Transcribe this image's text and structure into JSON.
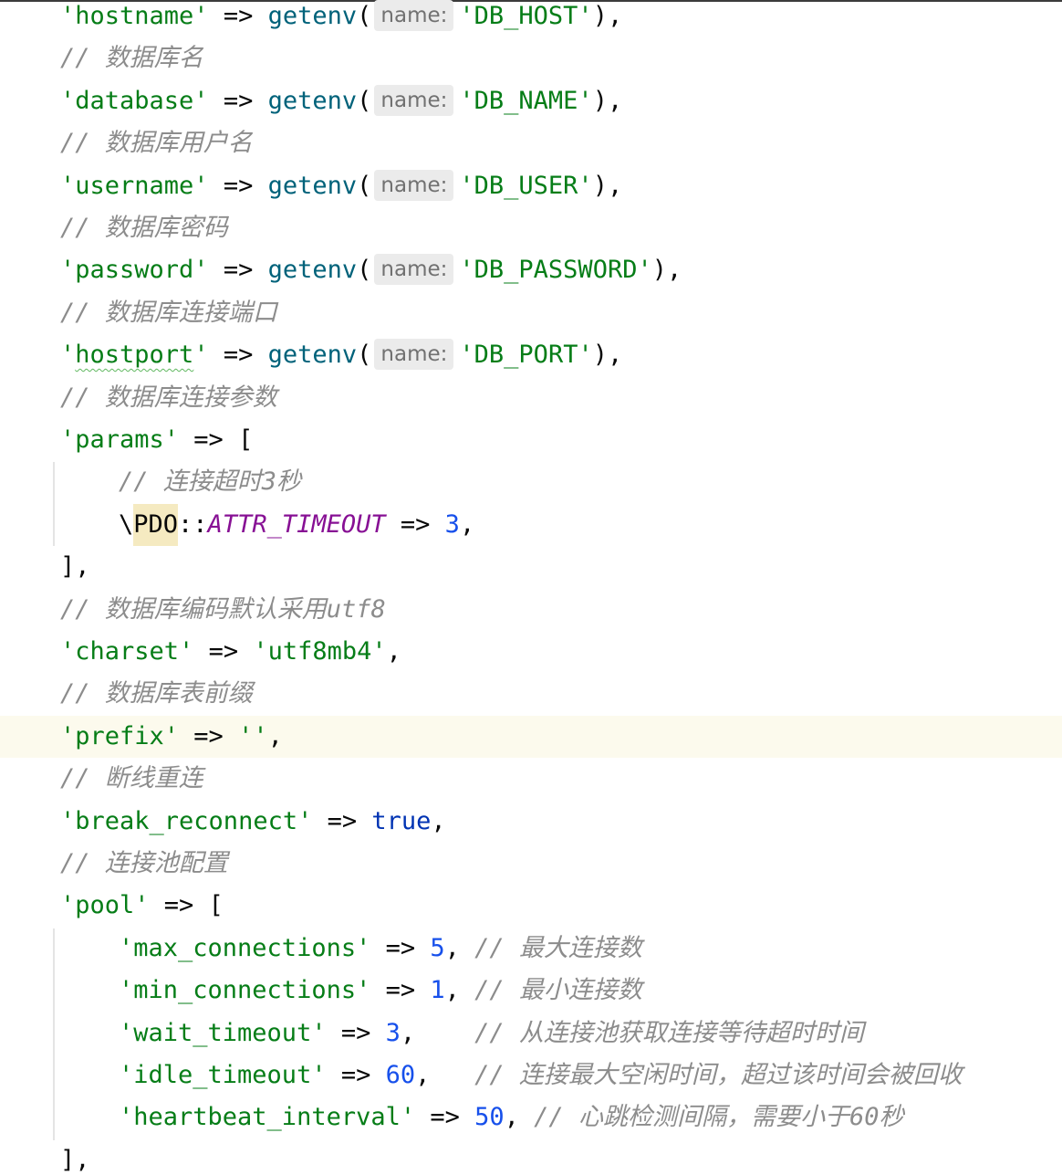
{
  "lines": [
    {
      "indent": 1,
      "tokens": [
        [
          "str",
          "'hostname'"
        ],
        [
          "op",
          " => "
        ],
        [
          "fn",
          "getenv"
        ],
        [
          "op",
          "("
        ],
        [
          "hint",
          "name:"
        ],
        [
          "str",
          "'DB_HOST'"
        ],
        [
          "op",
          "),"
        ]
      ]
    },
    {
      "indent": 1,
      "tokens": [
        [
          "cmt",
          "// 数据库名"
        ]
      ]
    },
    {
      "indent": 1,
      "tokens": [
        [
          "str",
          "'database'"
        ],
        [
          "op",
          " => "
        ],
        [
          "fn",
          "getenv"
        ],
        [
          "op",
          "("
        ],
        [
          "hint",
          "name:"
        ],
        [
          "str",
          "'DB_NAME'"
        ],
        [
          "op",
          "),"
        ]
      ]
    },
    {
      "indent": 1,
      "tokens": [
        [
          "cmt",
          "// 数据库用户名"
        ]
      ]
    },
    {
      "indent": 1,
      "tokens": [
        [
          "str",
          "'username'"
        ],
        [
          "op",
          " => "
        ],
        [
          "fn",
          "getenv"
        ],
        [
          "op",
          "("
        ],
        [
          "hint",
          "name:"
        ],
        [
          "str",
          "'DB_USER'"
        ],
        [
          "op",
          "),"
        ]
      ]
    },
    {
      "indent": 1,
      "tokens": [
        [
          "cmt",
          "// 数据库密码"
        ]
      ]
    },
    {
      "indent": 1,
      "tokens": [
        [
          "str",
          "'password'"
        ],
        [
          "op",
          " => "
        ],
        [
          "fn",
          "getenv"
        ],
        [
          "op",
          "("
        ],
        [
          "hint",
          "name:"
        ],
        [
          "str",
          "'DB_PASSWORD'"
        ],
        [
          "op",
          "),"
        ]
      ]
    },
    {
      "indent": 1,
      "tokens": [
        [
          "cmt",
          "// 数据库连接端口"
        ]
      ]
    },
    {
      "indent": 1,
      "tokens": [
        [
          "str",
          "'"
        ],
        [
          "typo",
          "hostport"
        ],
        [
          "str",
          "'"
        ],
        [
          "op",
          " => "
        ],
        [
          "fn",
          "getenv"
        ],
        [
          "op",
          "("
        ],
        [
          "hint",
          "name:"
        ],
        [
          "str",
          "'DB_PORT'"
        ],
        [
          "op",
          "),"
        ]
      ]
    },
    {
      "indent": 1,
      "tokens": [
        [
          "cmt",
          "// 数据库连接参数"
        ]
      ]
    },
    {
      "indent": 1,
      "tokens": [
        [
          "str",
          "'params'"
        ],
        [
          "op",
          " => ["
        ]
      ]
    },
    {
      "indent": 2,
      "tokens": [
        [
          "cmt",
          "// 连接超时3秒"
        ]
      ]
    },
    {
      "indent": 2,
      "tokens": [
        [
          "op",
          "\\"
        ],
        [
          "cls",
          "PDO"
        ],
        [
          "op",
          "::"
        ],
        [
          "const",
          "ATTR_TIMEOUT"
        ],
        [
          "op",
          " => "
        ],
        [
          "num",
          "3"
        ],
        [
          "op",
          ","
        ]
      ]
    },
    {
      "indent": 1,
      "tokens": [
        [
          "op",
          "],"
        ]
      ]
    },
    {
      "indent": 1,
      "tokens": [
        [
          "cmt",
          "// 数据库编码默认采用utf8"
        ]
      ]
    },
    {
      "indent": 1,
      "tokens": [
        [
          "str",
          "'charset'"
        ],
        [
          "op",
          " => "
        ],
        [
          "str",
          "'utf8mb4'"
        ],
        [
          "op",
          ","
        ]
      ]
    },
    {
      "indent": 1,
      "tokens": [
        [
          "cmt",
          "// 数据库表前缀"
        ]
      ]
    },
    {
      "indent": 1,
      "current": true,
      "tokens": [
        [
          "str",
          "'prefix'"
        ],
        [
          "op",
          " => "
        ],
        [
          "str",
          "''"
        ],
        [
          "op",
          ","
        ]
      ]
    },
    {
      "indent": 1,
      "tokens": [
        [
          "cmt",
          "// 断线重连"
        ]
      ]
    },
    {
      "indent": 1,
      "tokens": [
        [
          "str",
          "'break_reconnect'"
        ],
        [
          "op",
          " => "
        ],
        [
          "kw",
          "true"
        ],
        [
          "op",
          ","
        ]
      ]
    },
    {
      "indent": 1,
      "tokens": [
        [
          "cmt",
          "// 连接池配置"
        ]
      ]
    },
    {
      "indent": 1,
      "tokens": [
        [
          "str",
          "'pool'"
        ],
        [
          "op",
          " => ["
        ]
      ]
    },
    {
      "indent": 2,
      "tokens": [
        [
          "str",
          "'max_connections'"
        ],
        [
          "op",
          " => "
        ],
        [
          "num",
          "5"
        ],
        [
          "op",
          ", "
        ],
        [
          "cmt",
          "// 最大连接数"
        ]
      ]
    },
    {
      "indent": 2,
      "tokens": [
        [
          "str",
          "'min_connections'"
        ],
        [
          "op",
          " => "
        ],
        [
          "num",
          "1"
        ],
        [
          "op",
          ", "
        ],
        [
          "cmt",
          "// 最小连接数"
        ]
      ]
    },
    {
      "indent": 2,
      "tokens": [
        [
          "str",
          "'wait_timeout'"
        ],
        [
          "op",
          " => "
        ],
        [
          "num",
          "3"
        ],
        [
          "op",
          ",    "
        ],
        [
          "cmt",
          "// 从连接池获取连接等待超时时间"
        ]
      ]
    },
    {
      "indent": 2,
      "tokens": [
        [
          "str",
          "'idle_timeout'"
        ],
        [
          "op",
          " => "
        ],
        [
          "num",
          "60"
        ],
        [
          "op",
          ",   "
        ],
        [
          "cmt",
          "// 连接最大空闲时间，超过该时间会被回收"
        ]
      ]
    },
    {
      "indent": 2,
      "tokens": [
        [
          "str",
          "'heartbeat_interval'"
        ],
        [
          "op",
          " => "
        ],
        [
          "num",
          "50"
        ],
        [
          "op",
          ", "
        ],
        [
          "cmt",
          "// 心跳检测间隔，需要小于60秒"
        ]
      ]
    },
    {
      "indent": 1,
      "tokens": [
        [
          "op",
          "],"
        ]
      ]
    }
  ]
}
